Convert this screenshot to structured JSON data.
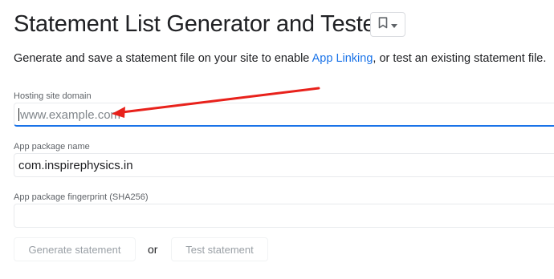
{
  "page": {
    "title": "Statement List Generator and Tester",
    "intro_before": "Generate and save a statement file on your site to enable ",
    "intro_link": "App Linking",
    "intro_after": ", or test an existing statement file."
  },
  "form": {
    "hosting_label": "Hosting site domain",
    "hosting_placeholder": "www.example.com",
    "package_label": "App package name",
    "package_value": "com.inspirephysics.in",
    "fingerprint_label": "App package fingerprint (SHA256)",
    "fingerprint_value": ""
  },
  "actions": {
    "generate_label": "Generate statement",
    "or_label": "or",
    "test_label": "Test statement"
  },
  "icons": {
    "bookmark": "bookmark-icon",
    "dropdown": "caret-down-icon"
  },
  "colors": {
    "link": "#1a73e8",
    "focus_underline": "#1a73e8",
    "annotation_arrow": "#e8211b"
  }
}
